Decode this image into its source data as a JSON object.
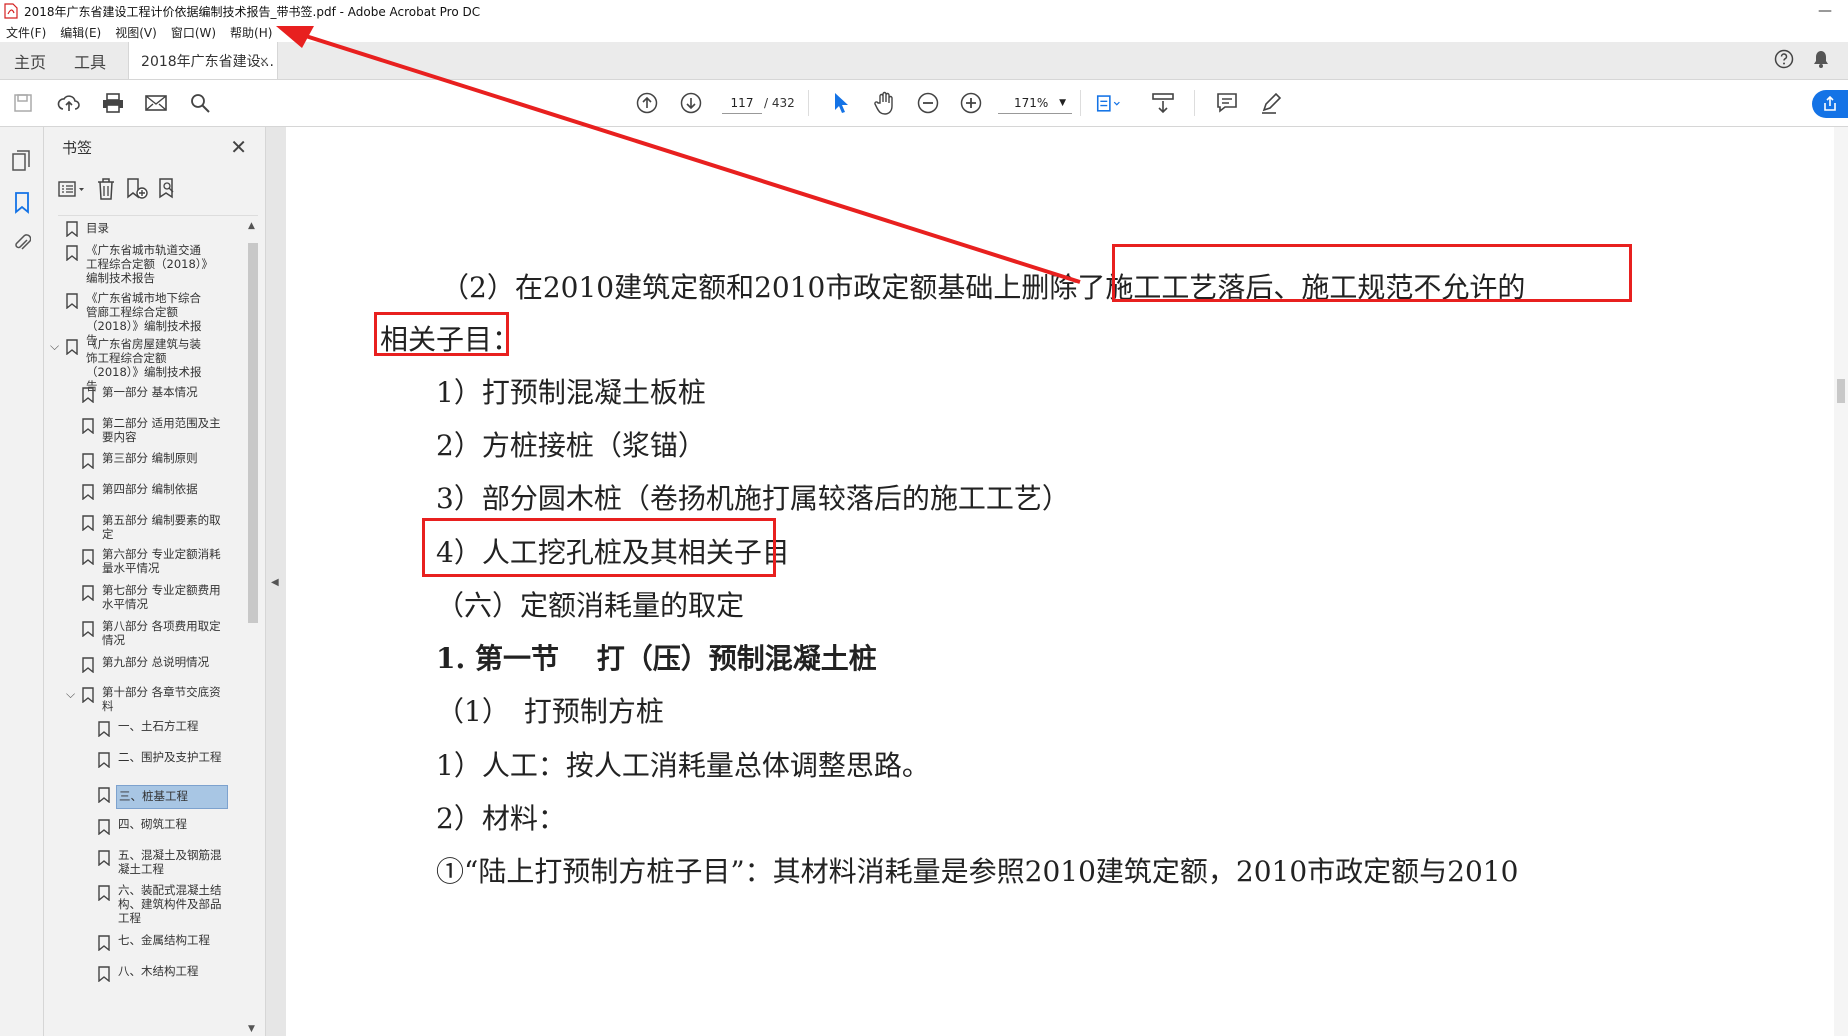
{
  "window": {
    "title": "2018年广东省建设工程计价依据编制技术报告_带书签.pdf - Adobe Acrobat Pro DC",
    "minimize": "—"
  },
  "menu": [
    "文件(F)",
    "编辑(E)",
    "视图(V)",
    "窗口(W)",
    "帮助(H)"
  ],
  "tabs": {
    "home": "主页",
    "tools": "工具",
    "document": "2018年广东省建设...",
    "close": "×"
  },
  "toolbar": {
    "page_current": "117",
    "page_total": "/ 432",
    "zoom": "171%"
  },
  "bookmarks_panel": {
    "title": "书签",
    "items": [
      {
        "label": "目录",
        "level": 0
      },
      {
        "label": "《广东省城市轨道交通工程综合定额（2018）》编制技术报告",
        "level": 0
      },
      {
        "label": "《广东省城市地下综合管廊工程综合定额（2018）》编制技术报告",
        "level": 0
      },
      {
        "label": "《广东省房屋建筑与装饰工程综合定额（2018）》编制技术报告",
        "level": 0,
        "expanded": true
      },
      {
        "label": "第一部分 基本情况",
        "level": 1
      },
      {
        "label": "第二部分 适用范围及主要内容",
        "level": 1
      },
      {
        "label": "第三部分 编制原则",
        "level": 1
      },
      {
        "label": "第四部分 编制依据",
        "level": 1
      },
      {
        "label": "第五部分 编制要素的取定",
        "level": 1
      },
      {
        "label": "第六部分 专业定额消耗量水平情况",
        "level": 1
      },
      {
        "label": "第七部分 专业定额费用水平情况",
        "level": 1
      },
      {
        "label": "第八部分 各项费用取定情况",
        "level": 1
      },
      {
        "label": "第九部分 总说明情况",
        "level": 1
      },
      {
        "label": "第十部分 各章节交底资料",
        "level": 1,
        "expanded": true
      },
      {
        "label": "一、土石方工程",
        "level": 2
      },
      {
        "label": "二、围护及支护工程",
        "level": 2
      },
      {
        "label": "三、桩基工程",
        "level": 2,
        "selected": true
      },
      {
        "label": "四、砌筑工程",
        "level": 2
      },
      {
        "label": "五、混凝土及钢筋混凝土工程",
        "level": 2
      },
      {
        "label": "六、装配式混凝土结构、建筑构件及部品工程",
        "level": 2
      },
      {
        "label": "七、金属结构工程",
        "level": 2
      },
      {
        "label": "八、木结构工程",
        "level": 2
      }
    ]
  },
  "document": {
    "lines": [
      "（2）在2010建筑定额和2010市政定额基础上删除了施工工艺落后、施工规范不允许的",
      "相关子目：",
      "1）打预制混凝土板桩",
      "2）方桩接桩（浆锚）",
      "3）部分圆木桩（卷扬机施打属较落后的施工工艺）",
      "4）人工挖孔桩及其相关子目",
      "（六）定额消耗量的取定",
      "1. 第一节　 打（压）预制混凝土桩",
      "（1）　打预制方桩",
      "1）人工：按人工消耗量总体调整思路。",
      "2）材料：",
      "①“陆上打预制方桩子目”：其材料消耗量是参照2010建筑定额，2010市政定额与2010"
    ]
  },
  "colors": {
    "annotation_red": "#e8201f",
    "accent_blue": "#1473e6",
    "selection": "#a8c6e4"
  }
}
